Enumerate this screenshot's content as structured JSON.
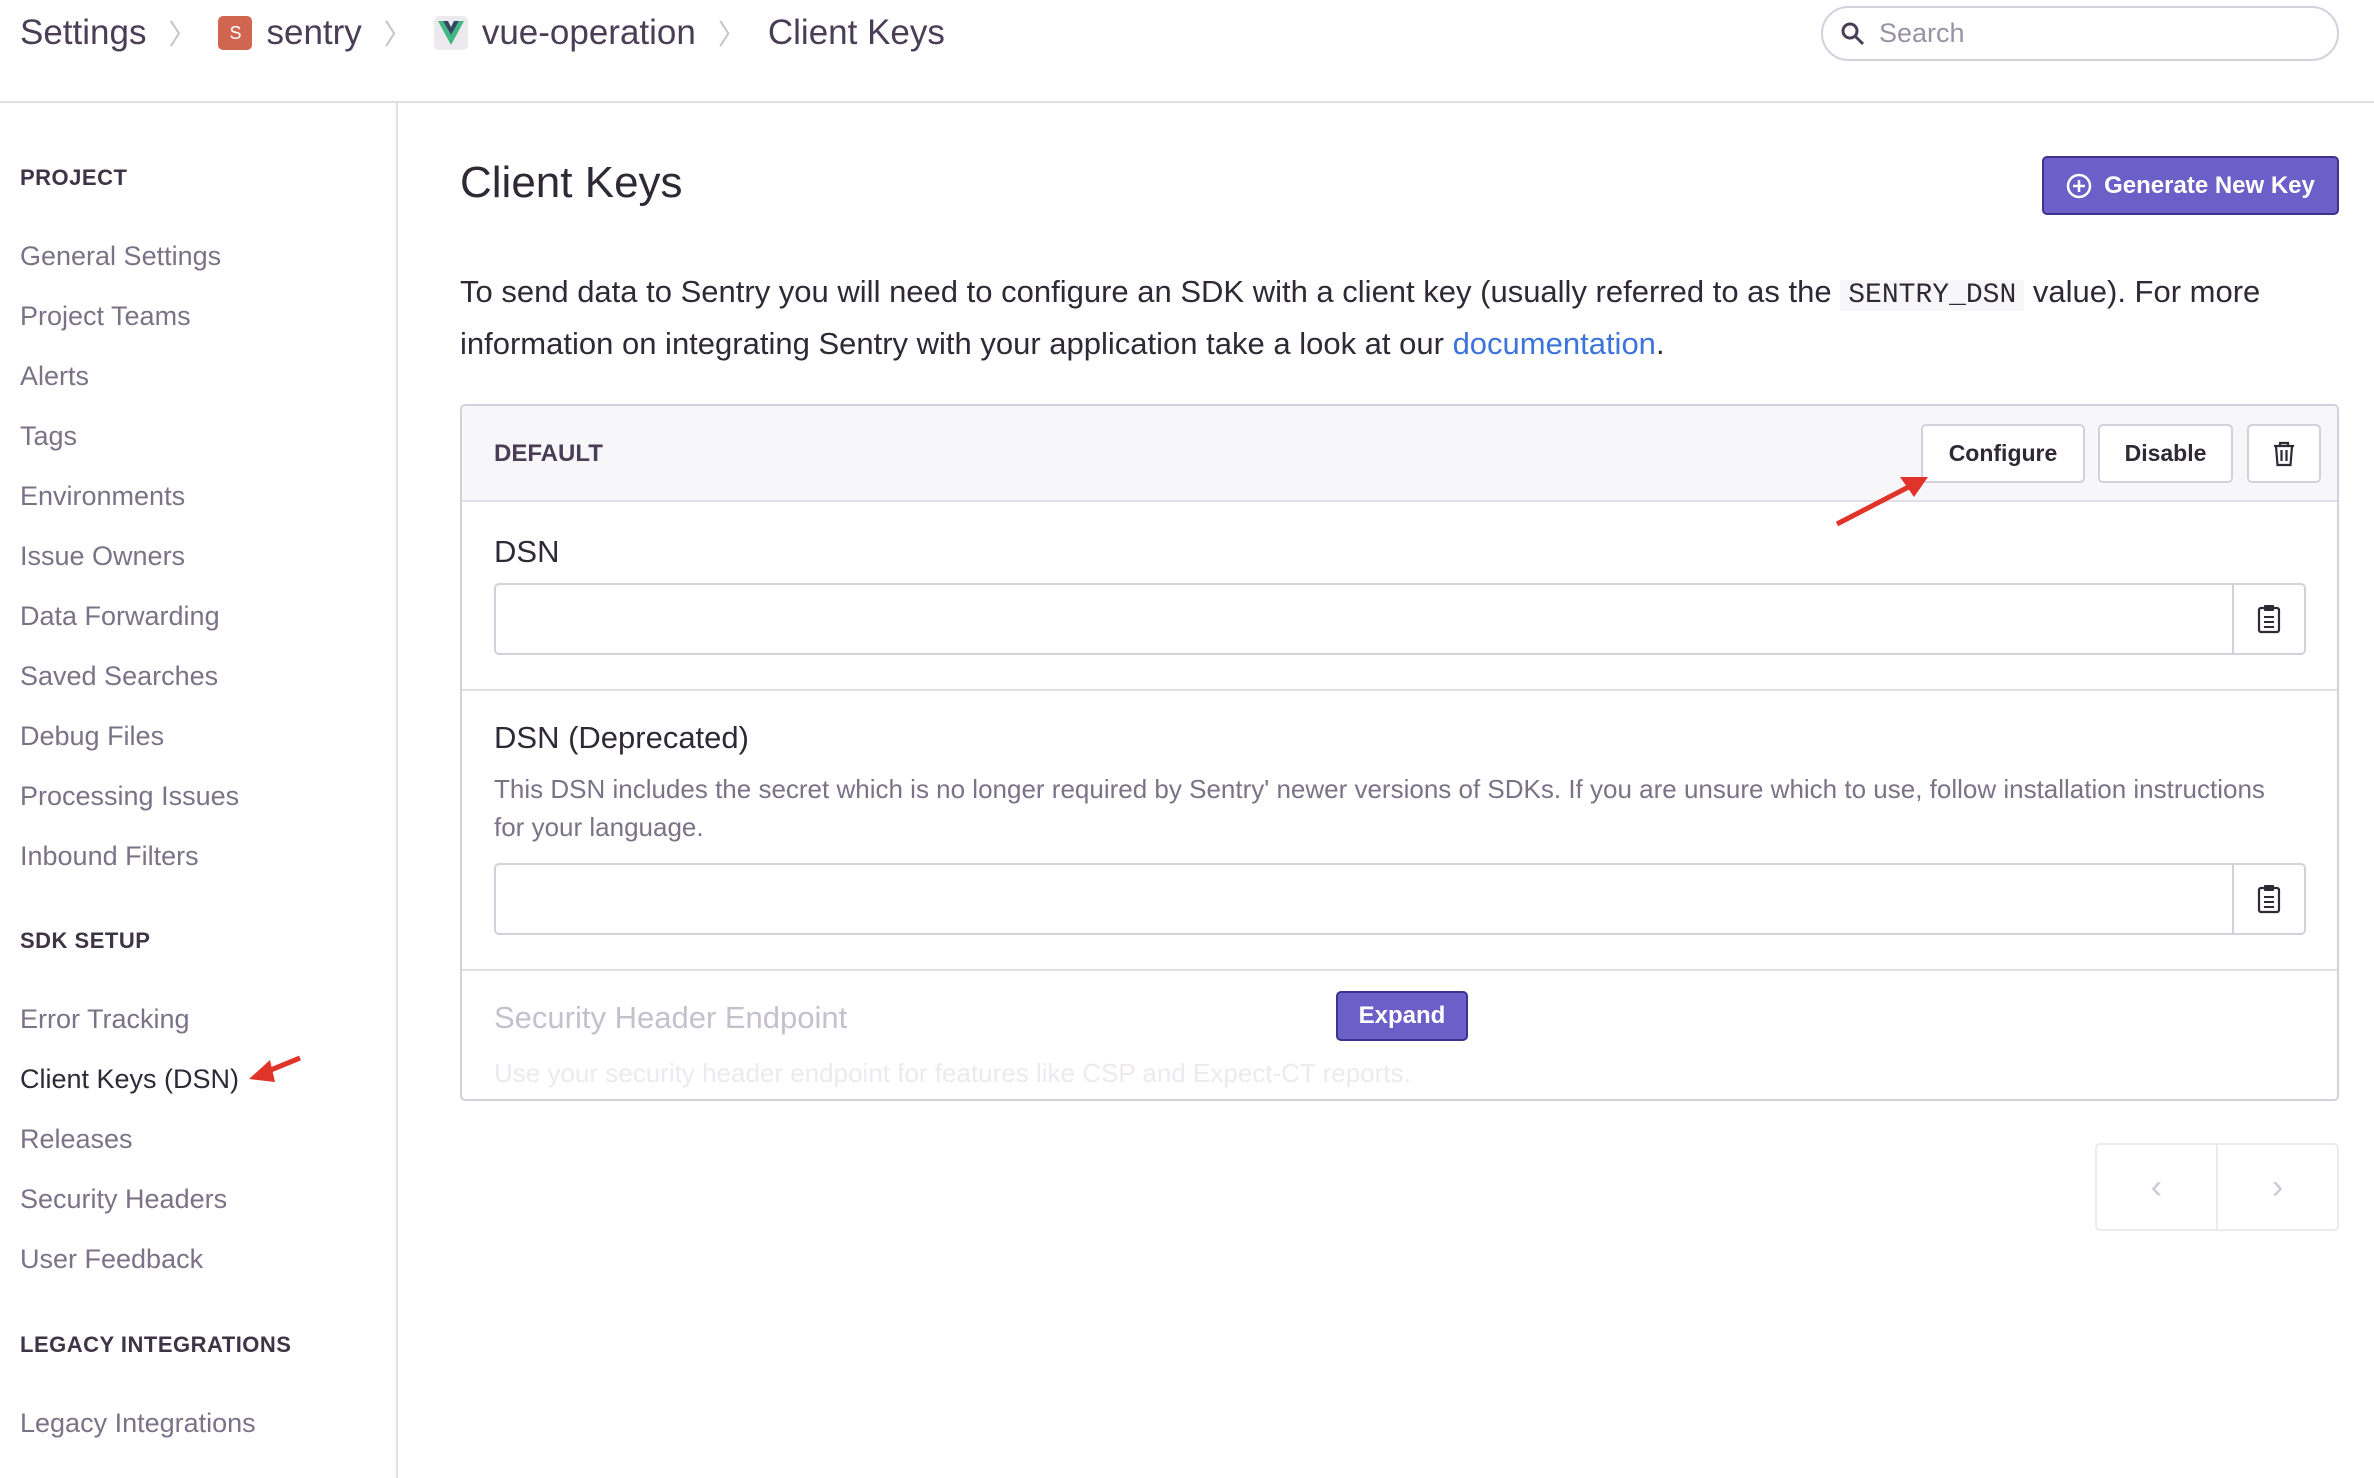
{
  "breadcrumb": {
    "settings": "Settings",
    "org": "sentry",
    "org_badge": "S",
    "project": "vue-operation",
    "page": "Client Keys"
  },
  "search": {
    "placeholder": "Search"
  },
  "sidebar": {
    "sections": [
      {
        "title": "PROJECT",
        "items": [
          "General Settings",
          "Project Teams",
          "Alerts",
          "Tags",
          "Environments",
          "Issue Owners",
          "Data Forwarding",
          "Saved Searches",
          "Debug Files",
          "Processing Issues",
          "Inbound Filters"
        ]
      },
      {
        "title": "SDK SETUP",
        "items": [
          "Error Tracking",
          "Client Keys (DSN)",
          "Releases",
          "Security Headers",
          "User Feedback"
        ]
      },
      {
        "title": "LEGACY INTEGRATIONS",
        "items": [
          "Legacy Integrations"
        ]
      }
    ],
    "active": "Client Keys (DSN)"
  },
  "main": {
    "title": "Client Keys",
    "generate_label": "Generate New Key",
    "intro_pre": "To send data to Sentry you will need to configure an SDK with a client key (usually referred to as the ",
    "intro_code": "SENTRY_DSN",
    "intro_mid": " value). For more information on integrating Sentry with your application take a look at our ",
    "intro_link": "documentation",
    "intro_end": "."
  },
  "key_panel": {
    "name": "DEFAULT",
    "configure": "Configure",
    "disable": "Disable",
    "dsn_label": "DSN",
    "dsn_value": "",
    "dep_label": "DSN (Deprecated)",
    "dep_help": "This DSN includes the secret which is no longer required by Sentry' newer versions of SDKs. If you are unsure which to use, follow installation instructions for your language.",
    "dep_value": "",
    "sec_label": "Security Header Endpoint",
    "sec_help": "Use your security header endpoint for features like CSP and Expect-CT reports.",
    "expand": "Expand"
  },
  "pagination": {
    "prev": "‹",
    "next": "›"
  },
  "colors": {
    "accent": "#6c5fc7",
    "link": "#3d74db",
    "annotation": "#e0332a"
  }
}
